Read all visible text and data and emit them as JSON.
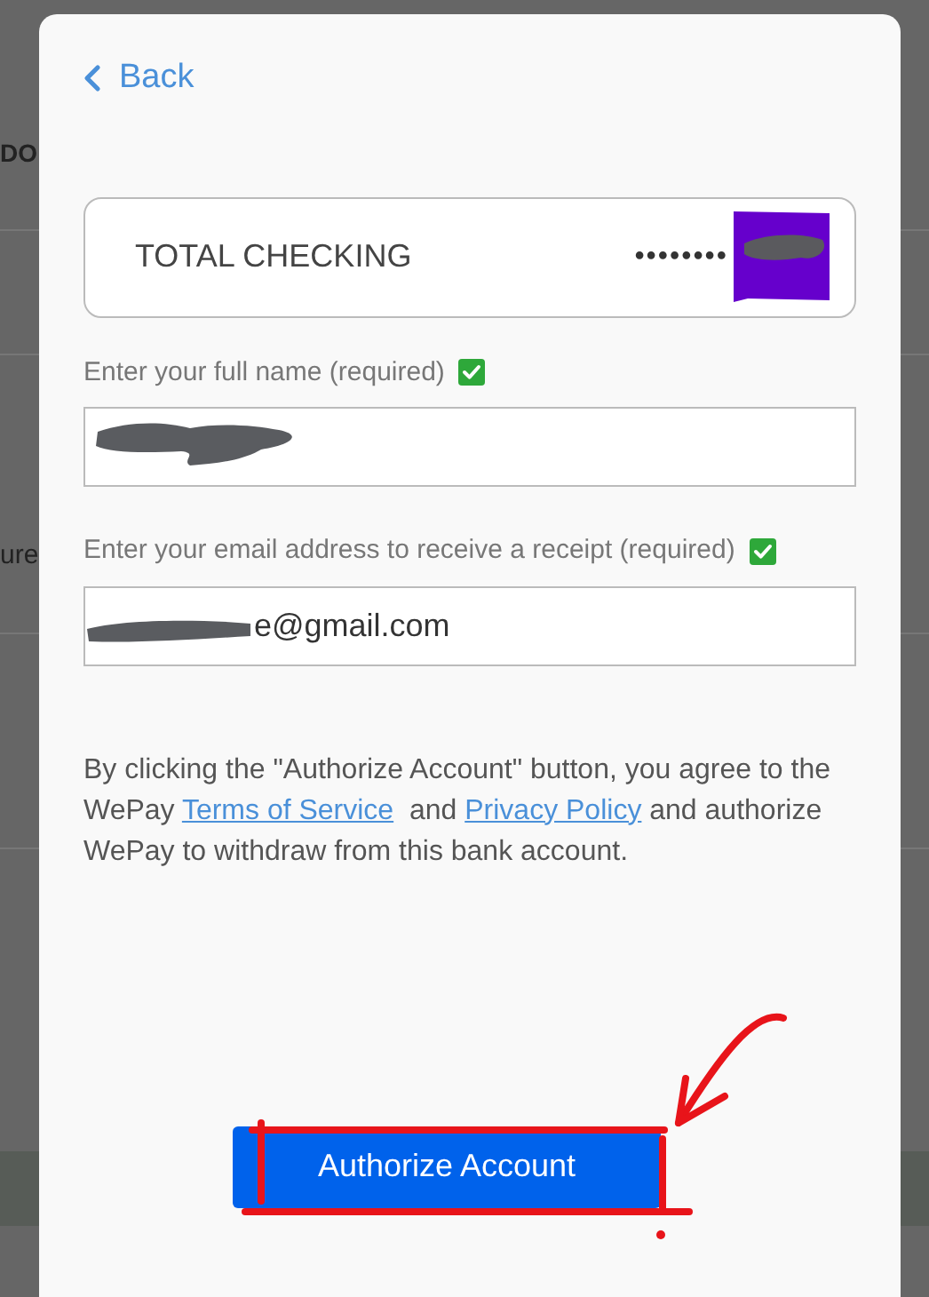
{
  "background": {
    "texts": [
      "DO",
      "ure"
    ]
  },
  "dialog": {
    "back": {
      "label": "Back"
    },
    "account": {
      "name": "TOTAL CHECKING",
      "mask": "••••••••",
      "redacted": true
    },
    "fields": [
      {
        "kind": "name",
        "label": "Enter your full name (required)",
        "checked": true,
        "redacted": true
      },
      {
        "kind": "email",
        "label": "Enter your email address to receive a receipt (required)",
        "checked": true,
        "redacted": true,
        "value": "e@gmail.com"
      }
    ],
    "consent": [
      {
        "kind": "text",
        "text": "By clicking the \"Authorize Account\" button, you agree to the WePay "
      },
      {
        "kind": "link",
        "text": "Terms of Service"
      },
      {
        "kind": "text",
        "text": "  and "
      },
      {
        "kind": "link",
        "text": "Privacy Policy"
      },
      {
        "kind": "text",
        "text": " and authorize WePay to withdraw from this bank account."
      }
    ],
    "button": {
      "label": "Authorize Account"
    }
  }
}
